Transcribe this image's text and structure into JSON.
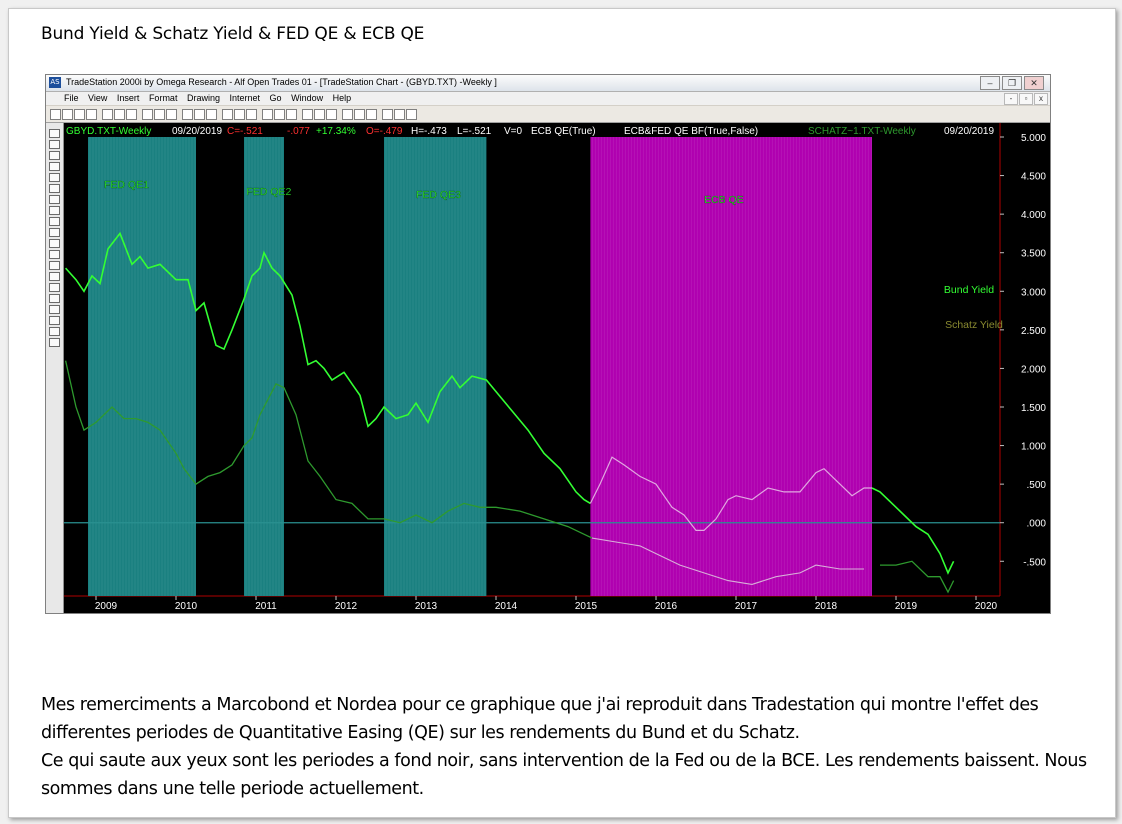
{
  "document": {
    "title": "Bund Yield & Schatz Yield & FED QE & ECB QE",
    "paragraph1": "Mes remerciments a Marcobond et Nordea pour ce graphique que j'ai reproduit dans Tradestation qui montre l'effet des differentes periodes de Quantitative Easing (QE) sur les rendements du Bund et du Schatz.",
    "paragraph2": "Ce qui saute aux yeux sont les periodes a fond noir, sans intervention de la Fed ou de la BCE. Les rendements baissent. Nous sommes dans une telle periode actuellement."
  },
  "window": {
    "title": "TradeStation 2000i by Omega Research - Alf Open Trades 01 - [TradeStation Chart - (GBYD.TXT) -Weekly ]",
    "app_icon": "tradestation-icon",
    "menu": [
      "File",
      "View",
      "Insert",
      "Format",
      "Drawing",
      "Internet",
      "Go",
      "Window",
      "Help"
    ],
    "controls": [
      "minimize-icon",
      "restore-icon",
      "close-icon"
    ]
  },
  "chart_header": {
    "symbol": "GBYD.TXT-Weekly",
    "date": "09/20/2019",
    "close": "C=-.521",
    "change": "-.077",
    "pct": "+17.34%",
    "open": "O=-.479",
    "high": "H=-.473",
    "low": "L=-.521",
    "volume": "V=0",
    "ind1": "ECB QE(True)",
    "ind2": "ECB&FED QE BF(True,False)",
    "symbol2": "SCHATZ~1.TXT-Weekly",
    "date2": "09/20/2019"
  },
  "colors": {
    "background": "#000000",
    "fed_qe_band": "#1a8080",
    "ecb_qe_band": "#b000b0",
    "bund": "#33ff33",
    "schatz": "#2e9a2e",
    "schatz_in_ecb": "#d8b0d8",
    "zero_line": "#2a9090",
    "axis_text": "#ffffff",
    "axis_line": "#b00000"
  },
  "chart_data": {
    "type": "line",
    "x_unit": "year",
    "xlim": [
      2008.6,
      2020.3
    ],
    "ylim": [
      -0.95,
      5.0
    ],
    "year_ticks": [
      "2009",
      "2010",
      "2011",
      "2012",
      "2013",
      "2014",
      "2015",
      "2016",
      "2017",
      "2018",
      "2019",
      "2020"
    ],
    "y_ticks": [
      "5.000",
      "4.500",
      "4.000",
      "3.500",
      "3.000",
      "2.500",
      "2.000",
      "1.500",
      "1.000",
      ".500",
      ".000",
      "-.500"
    ],
    "y_tick_values": [
      5.0,
      4.5,
      4.0,
      3.5,
      3.0,
      2.5,
      2.0,
      1.5,
      1.0,
      0.5,
      0.0,
      -0.5
    ],
    "zero_line": 0,
    "bands": [
      {
        "label": "FED QE1",
        "start": 2008.9,
        "end": 2010.25,
        "kind": "fed"
      },
      {
        "label": "FED QE2",
        "start": 2010.85,
        "end": 2011.35,
        "kind": "fed"
      },
      {
        "label": "FED QE3",
        "start": 2012.6,
        "end": 2013.88,
        "kind": "fed"
      },
      {
        "label": "ECB QE",
        "start": 2015.18,
        "end": 2018.7,
        "kind": "ecb"
      }
    ],
    "legend": [
      "Bund Yield",
      "Schatz Yield"
    ],
    "series": [
      {
        "name": "Bund Yield",
        "x": [
          2008.62,
          2008.75,
          2008.85,
          2008.95,
          2009.05,
          2009.15,
          2009.3,
          2009.45,
          2009.55,
          2009.65,
          2009.8,
          2010.0,
          2010.15,
          2010.25,
          2010.35,
          2010.5,
          2010.6,
          2010.7,
          2010.85,
          2010.95,
          2011.05,
          2011.1,
          2011.2,
          2011.3,
          2011.45,
          2011.55,
          2011.65,
          2011.75,
          2011.85,
          2011.95,
          2012.1,
          2012.2,
          2012.3,
          2012.4,
          2012.5,
          2012.6,
          2012.75,
          2012.9,
          2013.0,
          2013.15,
          2013.3,
          2013.45,
          2013.55,
          2013.7,
          2013.88,
          2014.0,
          2014.2,
          2014.4,
          2014.6,
          2014.8,
          2015.0,
          2015.1,
          2015.18,
          2015.3,
          2015.45,
          2015.6,
          2015.8,
          2016.0,
          2016.2,
          2016.35,
          2016.5,
          2016.6,
          2016.75,
          2016.9,
          2017.0,
          2017.2,
          2017.4,
          2017.6,
          2017.8,
          2018.0,
          2018.1,
          2018.25,
          2018.45,
          2018.6,
          2018.7,
          2018.8,
          2018.95,
          2019.1,
          2019.25,
          2019.4,
          2019.55,
          2019.65,
          2019.72
        ],
        "values": [
          3.3,
          3.15,
          3.0,
          3.2,
          3.1,
          3.55,
          3.75,
          3.35,
          3.45,
          3.3,
          3.35,
          3.15,
          3.15,
          2.75,
          2.85,
          2.3,
          2.25,
          2.5,
          2.9,
          3.2,
          3.3,
          3.5,
          3.3,
          3.2,
          2.95,
          2.55,
          2.05,
          2.1,
          2.0,
          1.85,
          1.95,
          1.8,
          1.65,
          1.25,
          1.35,
          1.5,
          1.35,
          1.4,
          1.55,
          1.3,
          1.7,
          1.9,
          1.75,
          1.9,
          1.85,
          1.7,
          1.45,
          1.2,
          0.9,
          0.7,
          0.4,
          0.3,
          0.25,
          0.5,
          0.85,
          0.75,
          0.6,
          0.5,
          0.2,
          0.1,
          -0.1,
          -0.1,
          0.05,
          0.3,
          0.35,
          0.3,
          0.45,
          0.4,
          0.4,
          0.65,
          0.7,
          0.55,
          0.35,
          0.45,
          0.45,
          0.4,
          0.25,
          0.1,
          -0.05,
          -0.15,
          -0.4,
          -0.65,
          -0.5
        ]
      },
      {
        "name": "Schatz Yield",
        "x": [
          2008.62,
          2008.75,
          2008.85,
          2009.0,
          2009.2,
          2009.35,
          2009.5,
          2009.65,
          2009.8,
          2010.0,
          2010.1,
          2010.25,
          2010.4,
          2010.55,
          2010.7,
          2010.85,
          2010.95,
          2011.05,
          2011.15,
          2011.25,
          2011.35,
          2011.5,
          2011.65,
          2011.8,
          2012.0,
          2012.2,
          2012.4,
          2012.6,
          2012.8,
          2013.0,
          2013.2,
          2013.4,
          2013.6,
          2013.8,
          2014.0,
          2014.3,
          2014.6,
          2014.9,
          2015.2,
          2015.5,
          2015.8,
          2016.0,
          2016.3,
          2016.6,
          2016.9,
          2017.2,
          2017.5,
          2017.8,
          2018.0,
          2018.3,
          2018.6,
          2018.8,
          2019.0,
          2019.2,
          2019.4,
          2019.55,
          2019.65,
          2019.72
        ],
        "values": [
          2.1,
          1.5,
          1.2,
          1.3,
          1.5,
          1.35,
          1.35,
          1.3,
          1.2,
          0.9,
          0.7,
          0.5,
          0.6,
          0.65,
          0.75,
          1.0,
          1.1,
          1.4,
          1.6,
          1.8,
          1.75,
          1.4,
          0.8,
          0.6,
          0.3,
          0.25,
          0.05,
          0.05,
          0.0,
          0.1,
          0.0,
          0.15,
          0.25,
          0.2,
          0.2,
          0.15,
          0.05,
          -0.05,
          -0.2,
          -0.25,
          -0.3,
          -0.4,
          -0.55,
          -0.65,
          -0.75,
          -0.8,
          -0.7,
          -0.65,
          -0.55,
          -0.6,
          -0.6,
          -0.55,
          -0.55,
          -0.5,
          -0.7,
          -0.7,
          -0.9,
          -0.75
        ]
      }
    ]
  }
}
